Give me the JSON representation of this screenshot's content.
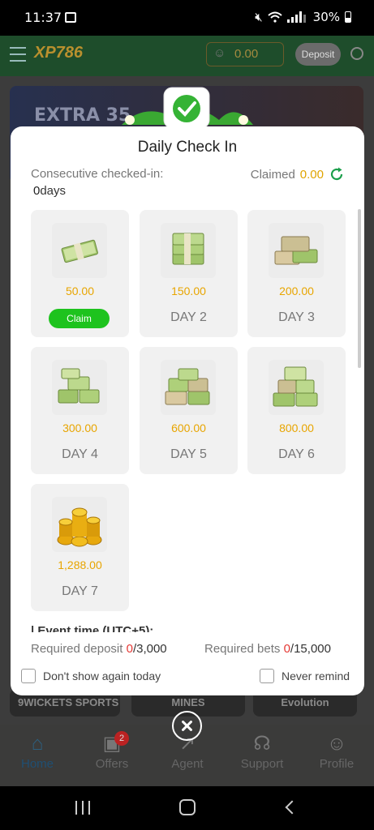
{
  "status_bar": {
    "time": "11:37",
    "battery": "30%"
  },
  "app": {
    "logo": "XP786",
    "balance": "0.00",
    "deposit_label": "Deposit",
    "banner_text": "EXTRA 35",
    "strip": [
      "9WICKETS SPORTS",
      "MINES",
      "Evolution"
    ]
  },
  "bottom_nav": {
    "items": [
      {
        "label": "Home",
        "icon": "home-icon"
      },
      {
        "label": "Offers",
        "icon": "gift-icon",
        "badge": "2"
      },
      {
        "label": "Agent",
        "icon": "share-icon"
      },
      {
        "label": "Support",
        "icon": "headset-icon"
      },
      {
        "label": "Profile",
        "icon": "user-icon"
      }
    ]
  },
  "modal": {
    "title": "Daily Check In",
    "consecutive_label": "Consecutive checked-in:",
    "consecutive_count": "0",
    "consecutive_unit": "days",
    "claimed_label": "Claimed",
    "claimed_amount": "0.00",
    "claim_button": "Claim",
    "days": [
      {
        "amount": "50.00",
        "label": ""
      },
      {
        "amount": "150.00",
        "label": "DAY 2"
      },
      {
        "amount": "200.00",
        "label": "DAY 3"
      },
      {
        "amount": "300.00",
        "label": "DAY 4"
      },
      {
        "amount": "600.00",
        "label": "DAY 5"
      },
      {
        "amount": "800.00",
        "label": "DAY 6"
      },
      {
        "amount": "1,288.00",
        "label": "DAY 7"
      }
    ],
    "event_time_partial": "| Event time (UTC+5):",
    "required_deposit_label": "Required deposit",
    "required_deposit_current": "0",
    "required_deposit_total": "/3,000",
    "required_bets_label": "Required bets",
    "required_bets_current": "0",
    "required_bets_total": "/15,000",
    "dont_show_today": "Don't show again today",
    "never_remind": "Never remind"
  },
  "colors": {
    "accent_gold": "#e8a500",
    "claim_green": "#1ec31e",
    "required_red": "#e53935"
  }
}
